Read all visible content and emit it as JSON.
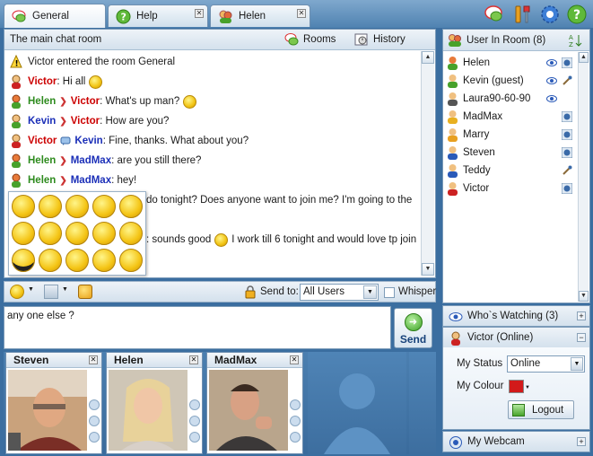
{
  "tabs": [
    {
      "label": "General",
      "active": true
    },
    {
      "label": "Help",
      "active": false
    },
    {
      "label": "Helen",
      "active": false
    }
  ],
  "top_icons": [
    "chat-bubbles-icon",
    "tools-icon",
    "settings-icon",
    "help-icon"
  ],
  "chat": {
    "room_title": "The main chat room",
    "rooms_label": "Rooms",
    "history_label": "History",
    "messages": [
      {
        "type": "system",
        "text": "Victor entered the room General"
      },
      {
        "from": "Victor",
        "to": "",
        "text": "Hi all",
        "smile": true
      },
      {
        "from": "Helen",
        "to": "Victor",
        "text": "What's up man?",
        "smile": true
      },
      {
        "from": "Kevin",
        "to": "Victor",
        "text": "How are you?"
      },
      {
        "from": "Victor",
        "to": "Kevin",
        "text": "Fine, thanks. What about you?",
        "whisper": true
      },
      {
        "from": "Helen",
        "to": "MadMax",
        "text": "are you still there?"
      },
      {
        "from": "Helen",
        "to": "MadMax",
        "text": "hey!"
      },
      {
        "from": "",
        "to": "",
        "text": "do tonight? Does anyone want  to join me? I'm going to the"
      },
      {
        "from": "",
        "to": "",
        "text": ": sounds good",
        "smile": true,
        "text2": "I work till 6 tonight and would love tp join"
      }
    ]
  },
  "colors": {
    "Victor": "#cc0000",
    "Helen": "#2e8b1e",
    "Kevin": "#1b2fb8",
    "MadMax": "#1b2fb8"
  },
  "toolbar": {
    "send_to_label": "Send to:",
    "send_to_value": "All Users",
    "whisper_label": "Whisper"
  },
  "input": {
    "value": "any one else ?",
    "send_label": "Send"
  },
  "webcams": [
    {
      "name": "Steven"
    },
    {
      "name": "Helen"
    },
    {
      "name": "MadMax"
    }
  ],
  "users_panel": {
    "title": "User In Room (8)",
    "users": [
      {
        "name": "Helen",
        "icons": [
          "eye-icon",
          "webcam-icon"
        ]
      },
      {
        "name": "Kevin (guest)",
        "icons": [
          "eye-icon",
          "mic-icon"
        ]
      },
      {
        "name": "Laura90-60-90",
        "icons": [
          "eye-icon"
        ]
      },
      {
        "name": "MadMax",
        "icons": [
          "webcam-icon"
        ]
      },
      {
        "name": "Marry",
        "icons": [
          "webcam-icon"
        ]
      },
      {
        "name": "Steven",
        "icons": [
          "webcam-icon"
        ]
      },
      {
        "name": "Teddy",
        "icons": [
          "mic-icon"
        ]
      },
      {
        "name": "Victor",
        "icons": [
          "webcam-icon"
        ]
      }
    ]
  },
  "whos_watching": {
    "title": "Who`s Watching (3)"
  },
  "victor_panel": {
    "title": "Victor (Online)",
    "status_label": "My Status",
    "status_value": "Online",
    "colour_label": "My Colour",
    "colour_value": "#d21a1a",
    "logout_label": "Logout"
  },
  "webcam_panel": {
    "title": "My Webcam"
  }
}
